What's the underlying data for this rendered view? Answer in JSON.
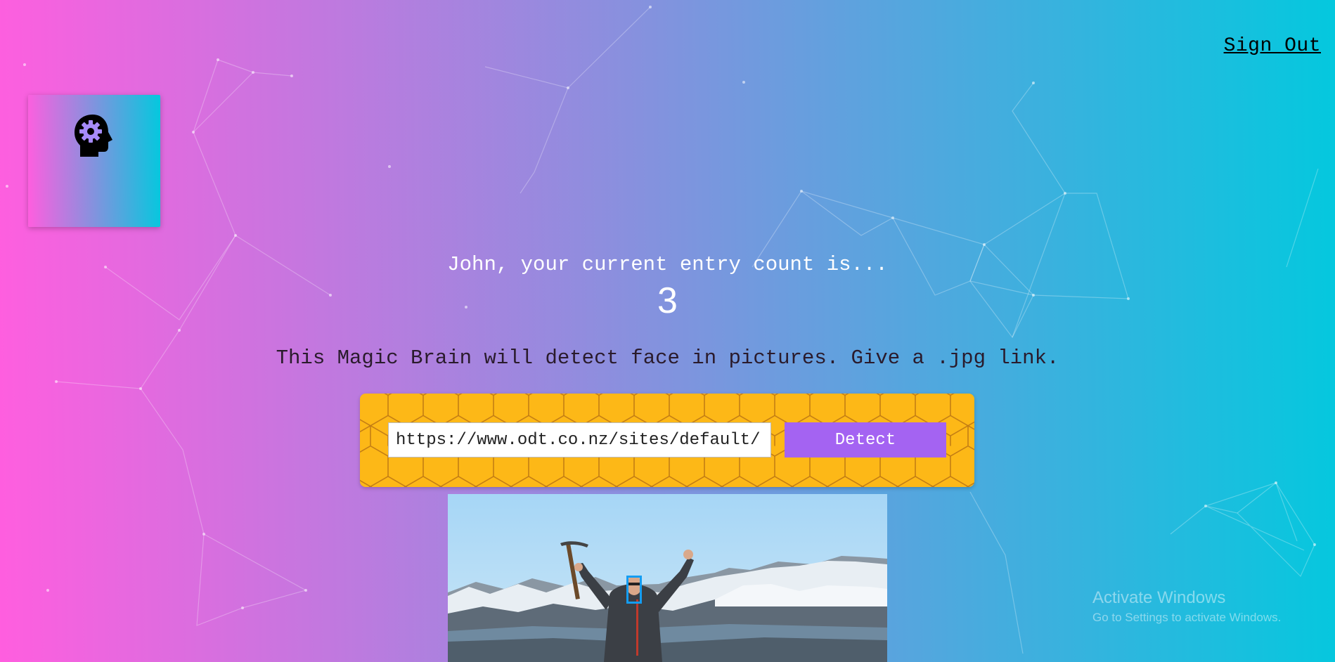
{
  "header": {
    "sign_out_label": "Sign Out"
  },
  "logo": {
    "icon": "brain-gear-head-icon"
  },
  "rank": {
    "message": "John, your current entry count is...",
    "count": "3"
  },
  "description": "This Magic Brain will detect face in pictures. Give a .jpg link.",
  "form": {
    "url_value": "https://www.odt.co.nz/sites/default/",
    "button_label": "Detect"
  },
  "photo": {
    "subject": "person-with-ice-axe-on-mountain-photo",
    "face_box_color": "#149df2"
  },
  "watermark": {
    "title": "Activate Windows",
    "subtitle": "Go to Settings to activate Windows."
  },
  "colors": {
    "gradient_start": "#ff5edf",
    "gradient_end": "#04c8de",
    "panel": "#fdb817",
    "button": "#a463f2"
  }
}
